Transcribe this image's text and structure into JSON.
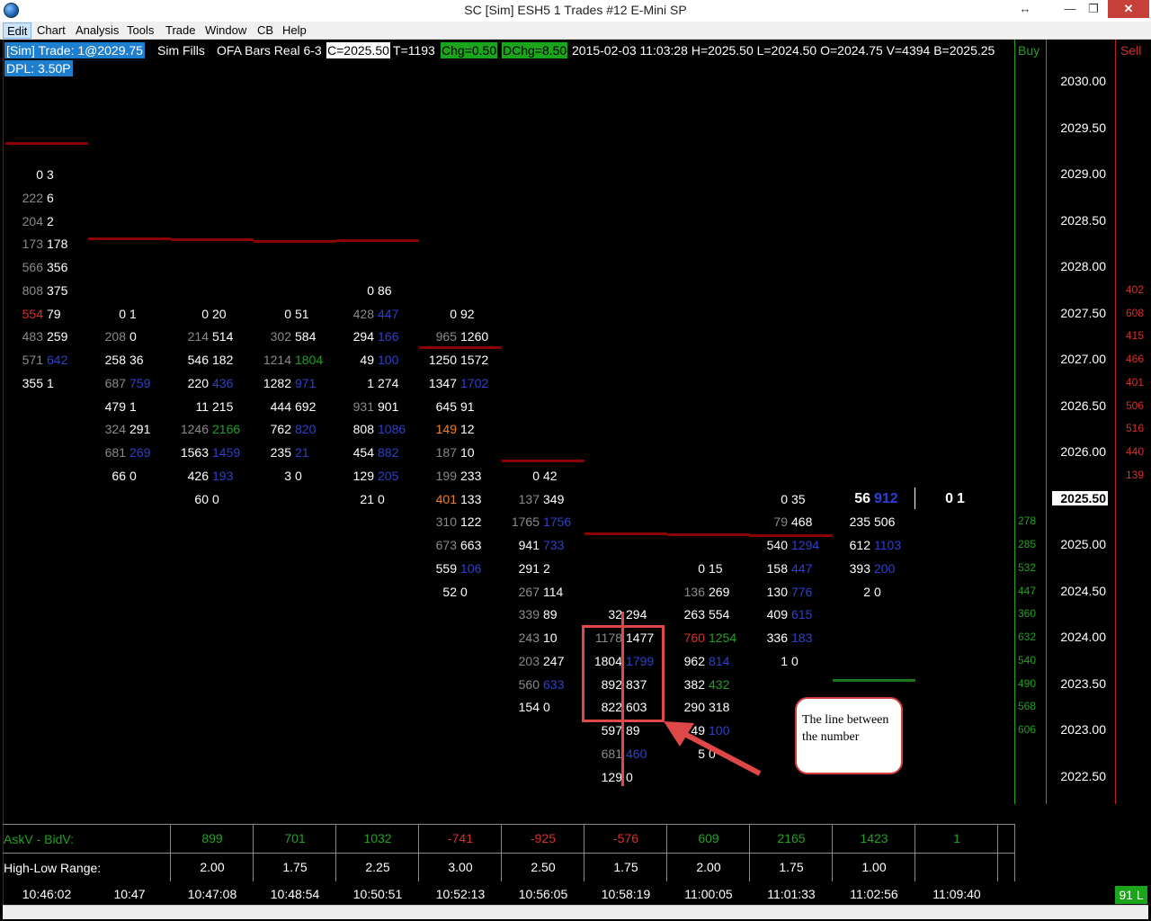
{
  "window": {
    "title": "SC [Sim] ESH5  1 Trades  #12  E-Mini SP",
    "move_glyph": "↔",
    "min_glyph": "—",
    "restore_glyph": "❐",
    "close_glyph": "✕"
  },
  "menu": [
    "Edit",
    "Chart",
    "Analysis",
    "Tools",
    "Trade",
    "Window",
    "CB",
    "Help"
  ],
  "header": {
    "sim": "[Sim]  Trade: 1@2029.75",
    "fills": "Sim Fills",
    "study": "OFA Bars Real 6-3",
    "close": "C=2025.50",
    "ticks": "T=1193",
    "chg": "Chg=0.50",
    "dchg": "DChg=8.50",
    "stats": "2015-02-03 11:03:28 H=2025.50 L=2024.50 O=2024.75 V=4394 B=2025.25",
    "dpl": "DPL: 3.50P",
    "buy_label": "Buy",
    "sell_label": "Sell"
  },
  "prices": [
    "2030.00",
    "2029.50",
    "2029.00",
    "2028.50",
    "2028.00",
    "2027.50",
    "2027.00",
    "2026.50",
    "2026.00",
    "2025.50",
    "2025.00",
    "2024.50",
    "2024.00",
    "2023.50",
    "2023.00",
    "2022.50"
  ],
  "current_price": "2025.50",
  "buy_values": [
    "278",
    "285",
    "532",
    "447",
    "360",
    "632",
    "540",
    "490",
    "568",
    "606"
  ],
  "sell_values": [
    "402",
    "608",
    "415",
    "466",
    "401",
    "506",
    "516",
    "440",
    "139"
  ],
  "columns": [
    {
      "rows": [
        [
          "0",
          "3",
          "w",
          "w"
        ],
        [
          "222",
          "6",
          "g",
          "w"
        ],
        [
          "204",
          "2",
          "g",
          "w"
        ],
        [
          "173",
          "178",
          "g",
          "w"
        ],
        [
          "566",
          "356",
          "g",
          "w"
        ],
        [
          "808",
          "375",
          "g",
          "w"
        ],
        [
          "554",
          "79",
          "r",
          "w"
        ],
        [
          "483",
          "259",
          "g",
          "w"
        ],
        [
          "571",
          "642",
          "g",
          "b"
        ],
        [
          "355",
          "1",
          "w",
          "w"
        ]
      ]
    },
    {
      "rows": [
        [
          "0",
          "1",
          "w",
          "w"
        ],
        [
          "208",
          "0",
          "g",
          "w"
        ],
        [
          "258",
          "36",
          "w",
          "w"
        ],
        [
          "687",
          "759",
          "g",
          "b"
        ],
        [
          "479",
          "1",
          "w",
          "w"
        ],
        [
          "324",
          "291",
          "g",
          "w"
        ],
        [
          "681",
          "269",
          "g",
          "b"
        ],
        [
          "66",
          "0",
          "w",
          "w"
        ]
      ]
    },
    {
      "rows": [
        [
          "0",
          "20",
          "w",
          "w"
        ],
        [
          "214",
          "514",
          "g",
          "w"
        ],
        [
          "546",
          "182",
          "w",
          "w"
        ],
        [
          "220",
          "436",
          "w",
          "b"
        ],
        [
          "11",
          "215",
          "w",
          "w"
        ],
        [
          "1246",
          "2166",
          "g",
          "gr"
        ],
        [
          "1563",
          "1459",
          "w",
          "b"
        ],
        [
          "426",
          "193",
          "w",
          "b"
        ],
        [
          "60",
          "0",
          "w",
          "w"
        ]
      ]
    },
    {
      "rows": [
        [
          "0",
          "51",
          "w",
          "w"
        ],
        [
          "302",
          "584",
          "g",
          "w"
        ],
        [
          "1214",
          "1804",
          "g",
          "gr"
        ],
        [
          "1282",
          "971",
          "w",
          "b"
        ],
        [
          "444",
          "692",
          "w",
          "w"
        ],
        [
          "762",
          "820",
          "w",
          "b"
        ],
        [
          "235",
          "21",
          "w",
          "b"
        ],
        [
          "3",
          "0",
          "w",
          "w"
        ]
      ]
    },
    {
      "rows": [
        [
          "0",
          "86",
          "w",
          "w"
        ],
        [
          "428",
          "447",
          "g",
          "b"
        ],
        [
          "294",
          "166",
          "w",
          "b"
        ],
        [
          "49",
          "100",
          "w",
          "b"
        ],
        [
          "1",
          "274",
          "w",
          "w"
        ],
        [
          "931",
          "901",
          "g",
          "w"
        ],
        [
          "808",
          "1086",
          "w",
          "b"
        ],
        [
          "454",
          "882",
          "w",
          "b"
        ],
        [
          "129",
          "205",
          "w",
          "b"
        ],
        [
          "21",
          "0",
          "w",
          "w"
        ]
      ]
    },
    {
      "rows": [
        [
          "0",
          "92",
          "w",
          "w"
        ],
        [
          "965",
          "1260",
          "g",
          "w"
        ],
        [
          "1250",
          "1572",
          "w",
          "w"
        ],
        [
          "1347",
          "1702",
          "w",
          "b"
        ],
        [
          "645",
          "91",
          "w",
          "w"
        ],
        [
          "149",
          "12",
          "o",
          "w"
        ],
        [
          "187",
          "10",
          "g",
          "w"
        ],
        [
          "199",
          "233",
          "g",
          "w"
        ],
        [
          "401",
          "133",
          "o",
          "w"
        ],
        [
          "310",
          "122",
          "g",
          "w"
        ],
        [
          "673",
          "663",
          "g",
          "w"
        ],
        [
          "559",
          "106",
          "w",
          "b"
        ],
        [
          "52",
          "0",
          "w",
          "w"
        ]
      ]
    },
    {
      "rows": [
        [
          "0",
          "42",
          "w",
          "w"
        ],
        [
          "137",
          "349",
          "g",
          "w"
        ],
        [
          "1765",
          "1756",
          "g",
          "b"
        ],
        [
          "941",
          "733",
          "w",
          "b"
        ],
        [
          "291",
          "2",
          "w",
          "w"
        ],
        [
          "267",
          "114",
          "g",
          "w"
        ],
        [
          "339",
          "89",
          "g",
          "w"
        ],
        [
          "243",
          "10",
          "g",
          "w"
        ],
        [
          "203",
          "247",
          "g",
          "w"
        ],
        [
          "560",
          "633",
          "g",
          "b"
        ],
        [
          "154",
          "0",
          "w",
          "w"
        ]
      ]
    },
    {
      "rows": [
        [
          "32",
          "294",
          "w",
          "w"
        ],
        [
          "1178",
          "1477",
          "g",
          "w"
        ],
        [
          "1804",
          "1799",
          "w",
          "b"
        ],
        [
          "892",
          "837",
          "w",
          "w"
        ],
        [
          "822",
          "603",
          "w",
          "w"
        ],
        [
          "597",
          "89",
          "w",
          "w"
        ],
        [
          "681",
          "460",
          "g",
          "b"
        ],
        [
          "129",
          "0",
          "w",
          "w"
        ]
      ]
    },
    {
      "rows": [
        [
          "0",
          "15",
          "w",
          "w"
        ],
        [
          "136",
          "269",
          "g",
          "w"
        ],
        [
          "263",
          "554",
          "w",
          "w"
        ],
        [
          "760",
          "1254",
          "r",
          "gr"
        ],
        [
          "962",
          "814",
          "w",
          "b"
        ],
        [
          "382",
          "432",
          "w",
          "gr"
        ],
        [
          "290",
          "318",
          "w",
          "w"
        ],
        [
          "49",
          "100",
          "w",
          "b"
        ],
        [
          "5",
          "0",
          "w",
          "w"
        ]
      ]
    },
    {
      "rows": [
        [
          "0",
          "35",
          "w",
          "w"
        ],
        [
          "79",
          "468",
          "g",
          "w"
        ],
        [
          "540",
          "1294",
          "w",
          "b"
        ],
        [
          "158",
          "447",
          "w",
          "b"
        ],
        [
          "130",
          "776",
          "w",
          "b"
        ],
        [
          "409",
          "615",
          "w",
          "b"
        ],
        [
          "336",
          "183",
          "w",
          "b"
        ],
        [
          "1",
          "0",
          "w",
          "w"
        ]
      ]
    },
    {
      "rows": [
        [
          "56",
          "912",
          "w",
          "b"
        ],
        [
          "235",
          "506",
          "w",
          "w"
        ],
        [
          "612",
          "1103",
          "w",
          "b"
        ],
        [
          "393",
          "200",
          "w",
          "b"
        ],
        [
          "2",
          "0",
          "w",
          "w"
        ]
      ]
    },
    {
      "rows": [
        [
          "0",
          "1",
          "w",
          "w"
        ]
      ]
    }
  ],
  "table": {
    "row1_label": "AskV - BidV:",
    "row2_label": "High-Low Range:",
    "askv_bidv": [
      "899",
      "701",
      "1032",
      "-741",
      "-925",
      "-576",
      "609",
      "2165",
      "1423",
      "1"
    ],
    "high_low": [
      "2.00",
      "1.75",
      "2.25",
      "3.00",
      "2.50",
      "1.75",
      "2.00",
      "1.75",
      "1.00",
      ""
    ]
  },
  "times": [
    "10:46:02",
    "10:47",
    "10:47:08",
    "10:48:54",
    "10:50:51",
    "10:52:13",
    "10:56:05",
    "10:58:19",
    "11:00:05",
    "11:01:33",
    "11:02:56",
    "11:09:40"
  ],
  "status_badge": "91 L",
  "annotation": {
    "text": "The line between the number"
  },
  "colors": {
    "bid_blue": "#2c41d1",
    "positive_green": "#22a022",
    "negative_red": "#d43030",
    "highlight_orange": "#f08020",
    "level_line": "#8b0000",
    "annotation_red": "#e04848"
  }
}
